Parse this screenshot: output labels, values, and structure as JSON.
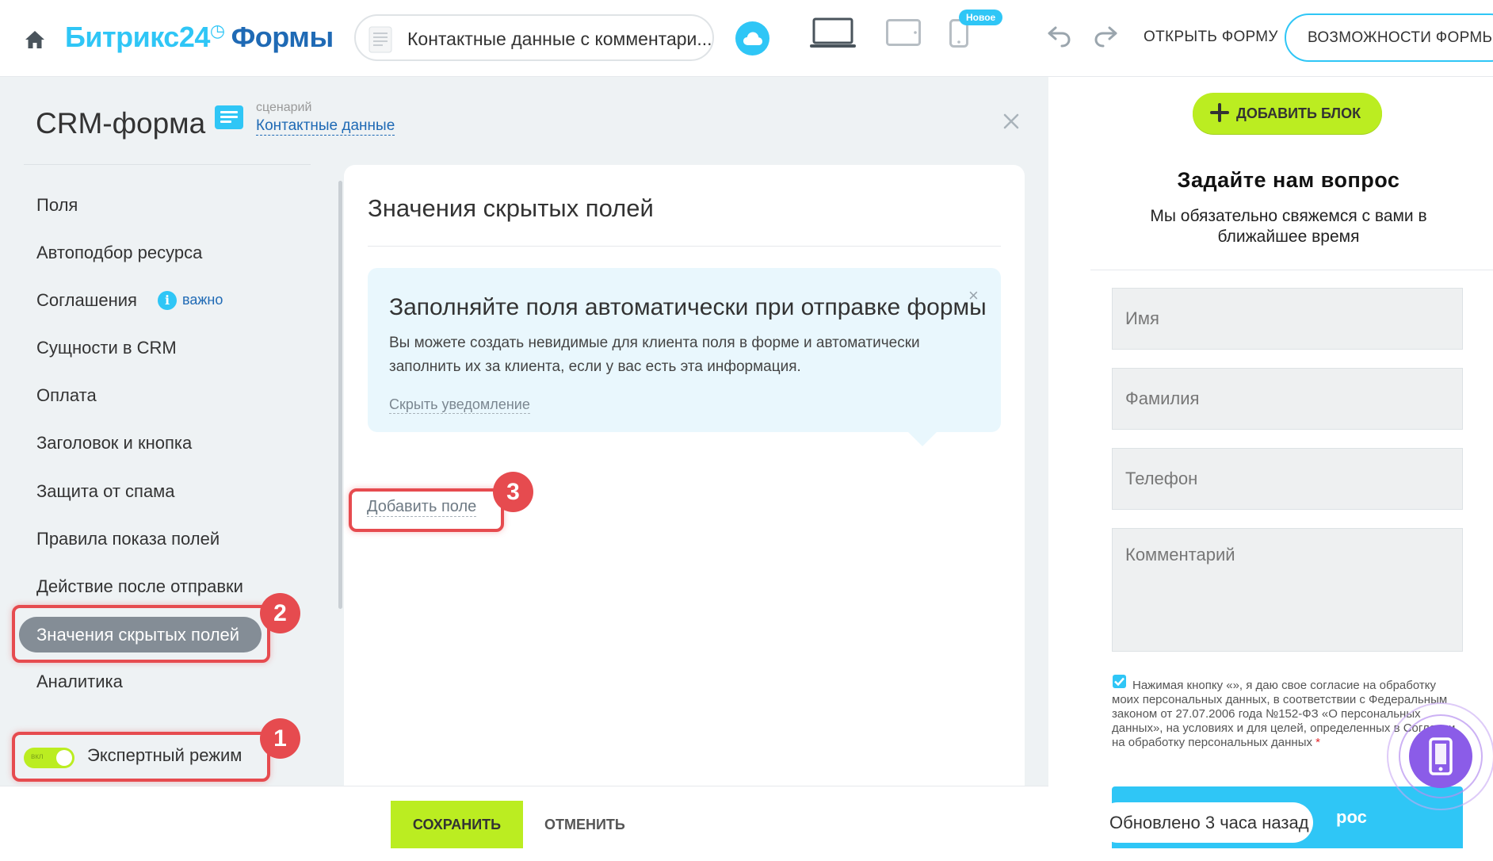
{
  "header": {
    "logo_main": "Битрикс24",
    "logo_clock": "◷",
    "logo_sub": "Формы",
    "form_selector": "Контактные данные с комментари...",
    "new_badge": "Новое",
    "open_form": "ОТКРЫТЬ ФОРМУ",
    "features": "ВОЗМОЖНОСТИ ФОРМЫ"
  },
  "panel": {
    "title": "CRM-форма",
    "scenario_caption": "сценарий",
    "scenario_link": "Контактные данные"
  },
  "nav": {
    "items": [
      "Поля",
      "Автоподбор ресурса",
      "Соглашения",
      "Сущности в CRM",
      "Оплата",
      "Заголовок и кнопка",
      "Защита от спама",
      "Правила показа полей",
      "Действие после отправки",
      "Значения скрытых полей",
      "Аналитика"
    ],
    "important_badge": "важно",
    "expert_toggle_state": "вкл",
    "expert_label": "Экспертный режим"
  },
  "card": {
    "title": "Значения скрытых полей",
    "notice_title": "Заполняйте поля автоматически при отправке формы",
    "notice_text": "Вы можете создать невидимые для клиента поля в форме и автоматически заполнить их за клиента, если у вас есть эта информация.",
    "notice_hide": "Скрыть уведомление",
    "add_field": "Добавить поле"
  },
  "actions": {
    "save": "СОХРАНИТЬ",
    "cancel": "ОТМЕНИТЬ"
  },
  "preview": {
    "add_block": "ДОБАВИТЬ БЛОК",
    "title": "Задайте нам вопрос",
    "subtitle": "Мы обязательно свяжемся с вами в ближайшее время",
    "fields": [
      "Имя",
      "Фамилия",
      "Телефон",
      "Комментарий"
    ],
    "consent": "Нажимая кнопку «», я даю свое согласие на обработку моих персональных данных, в соответствии с Федеральным законом от 27.07.2006 года №152-ФЗ «О персональных данных», на условиях и для целей, определенных в Согласии на обработку персональных данных",
    "consent_required": "*",
    "submit_fragment": "рос",
    "updated": "Обновлено 3 часа назад"
  },
  "annotations": [
    "1",
    "2",
    "3"
  ],
  "colors": {
    "accent_blue": "#2fc6f6",
    "brand_dark_blue": "#1f6ab5",
    "accent_green": "#bbed21",
    "annotation_red": "#e64b4f",
    "fab_purple": "#8b5ce8"
  }
}
